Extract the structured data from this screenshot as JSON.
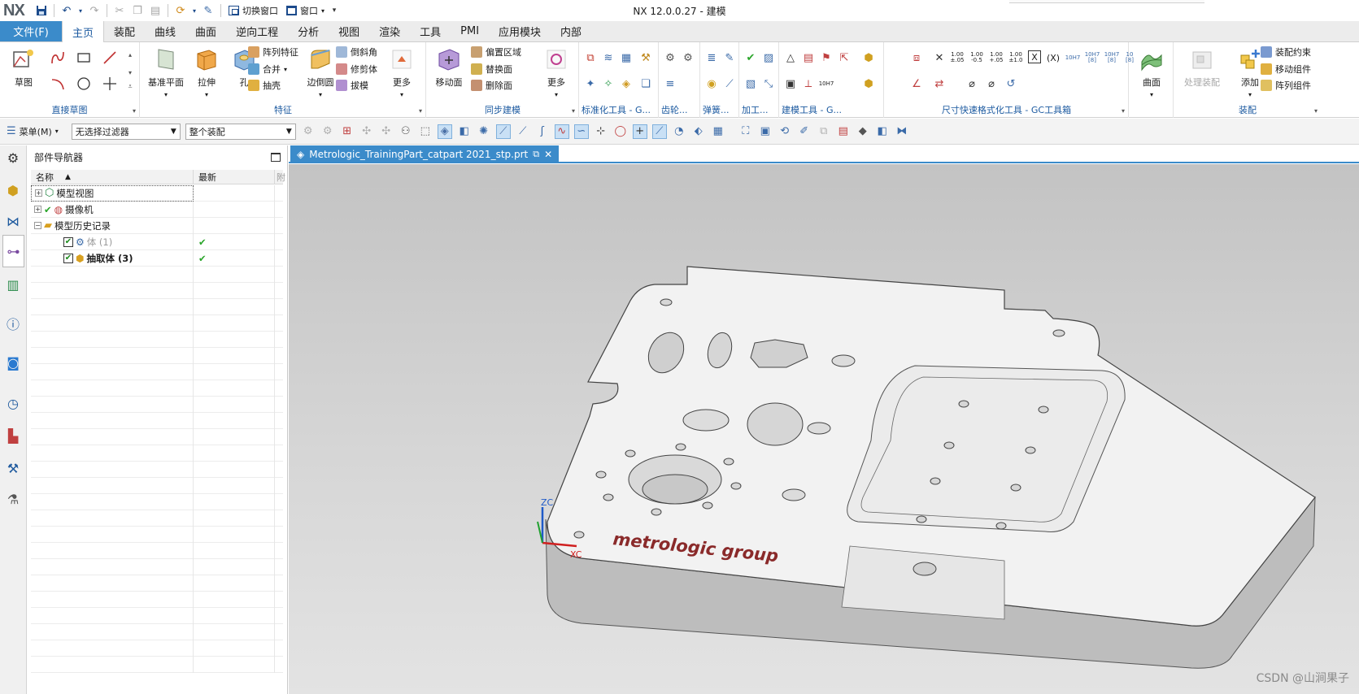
{
  "title_bar": {
    "logo": "NX",
    "app_title": "NX 12.0.0.27 - 建模",
    "switch_window_label": "切换窗口",
    "window_label": "窗口"
  },
  "tabs": [
    "文件(F)",
    "主页",
    "装配",
    "曲线",
    "曲面",
    "逆向工程",
    "分析",
    "视图",
    "渲染",
    "工具",
    "PMI",
    "应用模块",
    "内部"
  ],
  "active_tab": "主页",
  "ribbon": {
    "direct_sketch": {
      "label": "直接草图",
      "sketch_btn": "草图"
    },
    "feature": {
      "label": "特征",
      "datum_plane": "基准平面",
      "extrude": "拉伸",
      "hole": "孔",
      "pattern_feature": "阵列特征",
      "unite": "合并",
      "shell": "抽壳",
      "edge_blend": "边倒圆",
      "chamfer": "倒斜角",
      "trim_body": "修剪体",
      "draft": "拔模",
      "more": "更多"
    },
    "sync_modeling": {
      "label": "同步建模",
      "move_face": "移动面",
      "offset_region": "偏置区域",
      "replace_face": "替换面",
      "delete_face": "删除面",
      "more": "更多"
    },
    "groups_small": [
      "标准化工具 - G...",
      "齿轮...",
      "弹簧...",
      "加工...",
      "建模工具 - G...",
      "尺寸快速格式化工具 - GC工具箱"
    ],
    "dim_format_labels": [
      "1.00\n±.05",
      "1.00\n-0.5",
      "1.00\n+.05",
      "1.00\n±1.0",
      "X",
      "(X)",
      "10H7",
      "10H7\n[8]",
      "10H7\n[8]",
      "10\n[8]"
    ],
    "surface": {
      "label": "曲面"
    },
    "assembly": {
      "label": "装配",
      "process_assembly": "处理装配",
      "add": "添加",
      "assembly_constraint": "装配约束",
      "move_component": "移动组件",
      "pattern_component": "阵列组件"
    }
  },
  "selection_bar": {
    "menu_label": "菜单(M)",
    "type_filter": "无选择过滤器",
    "scope": "整个装配"
  },
  "navigator": {
    "title": "部件导航器",
    "columns": [
      "名称",
      "最新",
      "附"
    ],
    "rows": [
      {
        "label": "模型视图",
        "indent": 0,
        "expander": "+",
        "latest": "",
        "style": "normal"
      },
      {
        "label": "摄像机",
        "indent": 0,
        "expander": "+",
        "latest": "",
        "style": "normal"
      },
      {
        "label": "模型历史记录",
        "indent": 0,
        "expander": "−",
        "latest": "",
        "style": "normal"
      },
      {
        "label": "体 (1)",
        "indent": 1,
        "expander": "",
        "latest": "✔",
        "style": "gray"
      },
      {
        "label": "抽取体 (3)",
        "indent": 1,
        "expander": "",
        "latest": "✔",
        "style": "bold"
      }
    ],
    "empty_rows": 25
  },
  "viewport": {
    "tab_title": "Metrologic_TrainingPart_catpart 2021_stp.prt",
    "part_engraving": "metrologic group",
    "axis_z": "ZC",
    "axis_x": "XC"
  },
  "watermark": "CSDN @山涧果子",
  "colors": {
    "accent": "#3b8bca",
    "ribbon_group_label": "#1c5aa0",
    "check_green": "#2aa52a",
    "viewport_top": "#c3c3c3",
    "viewport_bottom": "#e3e3e3"
  }
}
